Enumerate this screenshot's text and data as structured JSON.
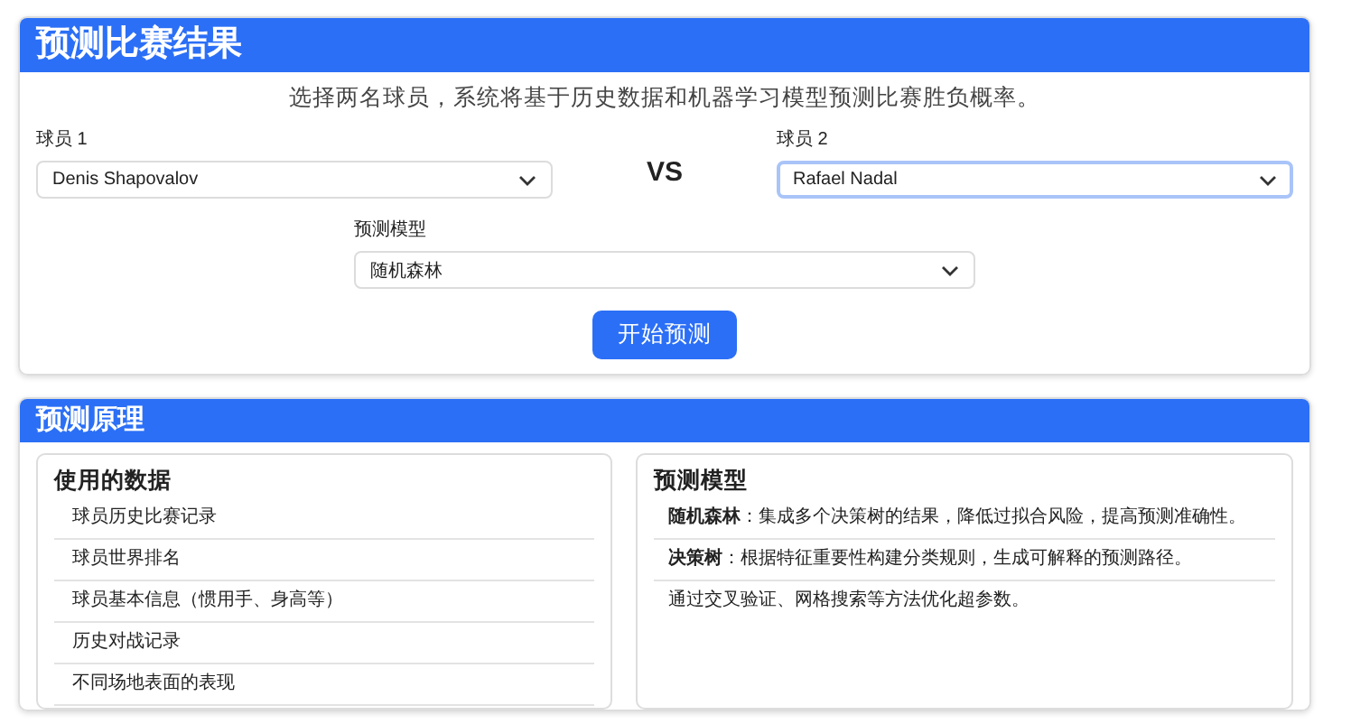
{
  "predict_card": {
    "title": "预测比赛结果",
    "description": "选择两名球员，系统将基于历史数据和机器学习模型预测比赛胜负概率。",
    "player1": {
      "label": "球员 1",
      "value": "Denis Shapovalov",
      "focused": false
    },
    "versus": "VS",
    "player2": {
      "label": "球员 2",
      "value": "Rafael Nadal",
      "focused": true
    },
    "model": {
      "label": "预测模型",
      "value": "随机森林",
      "focused": false
    },
    "submit_button": "开始预测"
  },
  "principle_card": {
    "title": "预测原理",
    "data_panel": {
      "title": "使用的数据",
      "items": [
        "球员历史比赛记录",
        "球员世界排名",
        "球员基本信息（惯用手、身高等）",
        "历史对战记录",
        "不同场地表面的表现"
      ]
    },
    "model_panel": {
      "title": "预测模型",
      "items": [
        "**随机森林**：集成多个决策树的结果，降低过拟合风险，提高预测准确性。",
        "**决策树**：根据特征重要性构建分类规则，生成可解释的预测路径。",
        "通过交叉验证、网格搜索等方法优化超参数。"
      ]
    }
  }
}
